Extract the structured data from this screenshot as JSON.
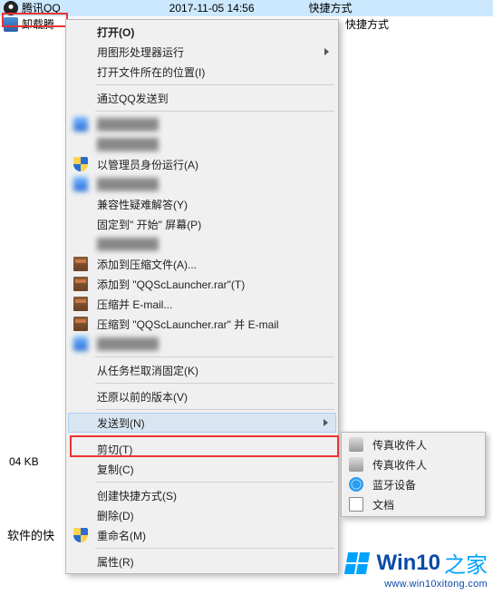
{
  "background": {
    "rows": [
      {
        "name": "腾讯QQ",
        "date": "2017-11-05 14:56",
        "type": "快捷方式"
      },
      {
        "name": "卸载腾",
        "date": "",
        "type": "快捷方式"
      }
    ],
    "size_text": "04 KB",
    "desc_text": "软件的快"
  },
  "menu": {
    "items": [
      {
        "label": "打开(O)",
        "bold": true
      },
      {
        "label": "用图形处理器运行",
        "arrow": true
      },
      {
        "label": "打开文件所在的位置(I)"
      }
    ],
    "items2": [
      {
        "label": "通过QQ发送到"
      }
    ],
    "items3": [
      {
        "label": "",
        "blur": true,
        "icon": "blueicon"
      },
      {
        "label": "",
        "blur": true
      },
      {
        "label": "以管理员身份运行(A)",
        "icon": "shield"
      },
      {
        "label": "",
        "blur": true,
        "icon": "blueicon"
      },
      {
        "label": "兼容性疑难解答(Y)"
      },
      {
        "label": "固定到\" 开始\" 屏幕(P)"
      },
      {
        "label": "",
        "blur": true
      },
      {
        "label": "添加到压缩文件(A)...",
        "icon": "rar"
      },
      {
        "label": "添加到 \"QQScLauncher.rar\"(T)",
        "icon": "rar"
      },
      {
        "label": "压缩并 E-mail...",
        "icon": "rar"
      },
      {
        "label": "压缩到 \"QQScLauncher.rar\" 并 E-mail",
        "icon": "rar"
      },
      {
        "label": "",
        "blur": true,
        "icon": "blueicon"
      }
    ],
    "items4": [
      {
        "label": "从任务栏取消固定(K)"
      }
    ],
    "items5": [
      {
        "label": "还原以前的版本(V)"
      }
    ],
    "send_to": {
      "label": "发送到(N)",
      "arrow": true,
      "hover": true
    },
    "items6": [
      {
        "label": "剪切(T)"
      },
      {
        "label": "复制(C)"
      }
    ],
    "items7": [
      {
        "label": "创建快捷方式(S)"
      },
      {
        "label": "删除(D)"
      },
      {
        "label": "重命名(M)",
        "icon": "shield"
      }
    ],
    "items8": [
      {
        "label": "属性(R)"
      }
    ]
  },
  "submenu": {
    "items": [
      {
        "label": "传真收件人",
        "icon": "fax"
      },
      {
        "label": "传真收件人",
        "icon": "fax"
      },
      {
        "label": "蓝牙设备",
        "icon": "bt"
      },
      {
        "label": "文档",
        "icon": "doc"
      }
    ]
  },
  "logo": {
    "brand_primary": "Win10",
    "brand_accent": "之家",
    "url": "www.win10xitong.com"
  }
}
